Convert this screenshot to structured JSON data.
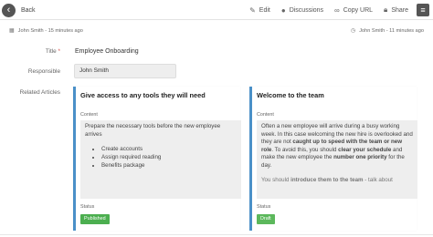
{
  "topbar": {
    "back_label": "Back",
    "actions": [
      {
        "label": "Edit",
        "icon": "pencil-icon"
      },
      {
        "label": "Discussions",
        "icon": "chat-icon"
      },
      {
        "label": "Copy URL",
        "icon": "link-icon"
      },
      {
        "label": "Share",
        "icon": "lock-icon"
      }
    ],
    "menu_icon": "hamburger-icon"
  },
  "meta": {
    "created": "John Smith - 15 minutes ago",
    "updated": "John Smith - 11 minutes ago"
  },
  "fields": {
    "title_label": "Title",
    "required_mark": "*",
    "title_value": "Employee Onboarding",
    "responsible_label": "Responsible",
    "responsible_value": "John Smith",
    "related_label": "Related Articles"
  },
  "articles": [
    {
      "title": "Give access to any tools they will need",
      "content_label": "Content",
      "intro": "Prepare the necessary tools before the new employee arrives",
      "bullets": [
        "Create accounts",
        "Assign required reading",
        "Benefits package"
      ],
      "status_label": "Status",
      "status": "Published"
    },
    {
      "title": "Welcome to the team",
      "content_label": "Content",
      "p1_a": "Often a new employee will arrive during a busy working week. In this case welcoming the new hire is overlooked and they are not ",
      "p1_b": "caught up to speed with the team or new role",
      "p1_c": ". To avoid this, you should ",
      "p1_d": "clear your schedule",
      "p1_e": " and make the new employee the ",
      "p1_f": "number one priority",
      "p1_g": " for the day.",
      "p2_a": "You should ",
      "p2_b": "introduce them to the team",
      "p2_c": " - talk about",
      "status_label": "Status",
      "status": "Draft"
    }
  ],
  "colors": {
    "accent": "#4a90c8",
    "published": "#4caf50",
    "draft": "#5cb85c"
  }
}
